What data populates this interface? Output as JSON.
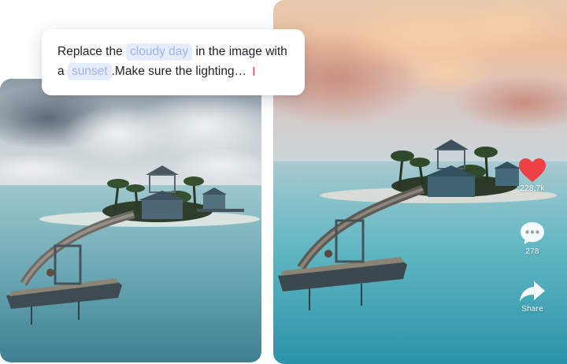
{
  "prompt": {
    "text_before": "Replace the",
    "chip_1": "cloudy day",
    "text_middle": "in the image with",
    "text_a": "a",
    "chip_2": "sunset",
    "text_after": ".Make sure the lighting…",
    "cursor_icon": "text-cursor-icon"
  },
  "actions": {
    "like": {
      "icon": "heart-icon",
      "count": "228.7k",
      "color": "#ee4045"
    },
    "comment": {
      "icon": "comment-bubble-icon",
      "count": "278"
    },
    "share": {
      "icon": "share-arrow-icon",
      "label": "Share"
    }
  },
  "images": {
    "before": {
      "description_icon": "cloudy-resort-photo"
    },
    "after": {
      "description_icon": "sunset-resort-photo"
    }
  }
}
